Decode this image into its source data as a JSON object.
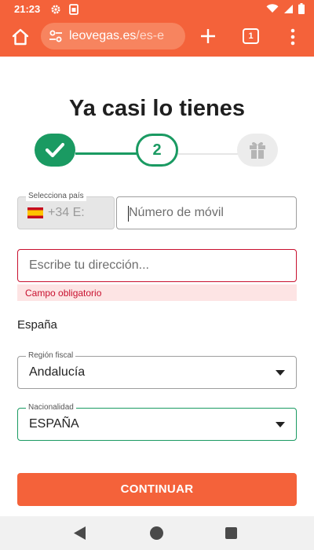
{
  "status_bar": {
    "time": "21:23",
    "icons": [
      "gear-icon",
      "sim-icon",
      "wifi-icon",
      "signal-icon",
      "battery-icon"
    ]
  },
  "browser": {
    "url_host": "leovegas.es",
    "url_path": "/es-e",
    "tab_count": "1",
    "accent_color": "#f4623a"
  },
  "page": {
    "title": "Ya casi lo tienes",
    "stepper": {
      "current_step_label": "2",
      "completed_color": "#1a9a62"
    },
    "phone": {
      "country_label": "Selecciona país",
      "flag": "🇪🇸",
      "country_code": "+34 E:",
      "placeholder": "Número de móvil"
    },
    "address": {
      "placeholder": "Escribe tu dirección...",
      "error": "Campo obligatorio",
      "error_color": "#c8102e"
    },
    "country_text": "España",
    "region": {
      "label": "Región fiscal",
      "value": "Andalucía"
    },
    "nationality": {
      "label": "Nacionalidad",
      "value": "ESPAÑA"
    },
    "continue_label": "CONTINUAR"
  }
}
